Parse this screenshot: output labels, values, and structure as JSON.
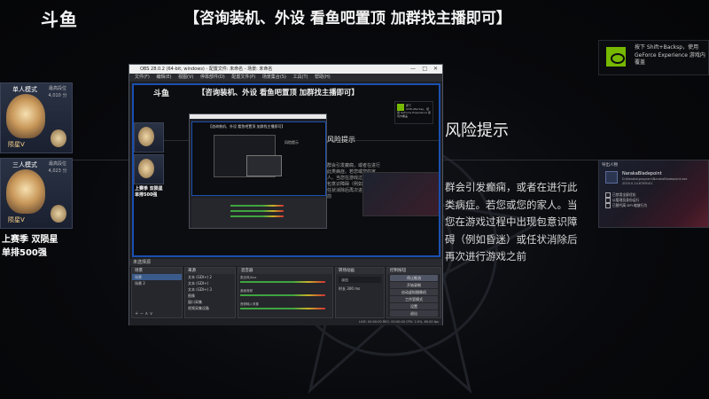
{
  "stream": {
    "logo": "斗鱼",
    "headline": "【咨询装机、外设 看鱼吧置顶 加群找主播即可】",
    "season_line1": "上赛季 双陨星",
    "season_line2": "单排500强",
    "risk_title": "风险提示",
    "warning": "群会引发癫痫，或者在进行此类病症。若您或您的家人。当您在游戏过程中出现包意识障碍（例如昏迷）或任状消除后再次进行游戏之前"
  },
  "rank_cards": [
    {
      "mode": "单人模式",
      "rank": "陨星V",
      "side": "最高段位 4,010 分"
    },
    {
      "mode": "三人模式",
      "rank": "陨星V",
      "side": "最高段位 4,023 分"
    }
  ],
  "obs": {
    "title": "OBS 28.0.2 (64-bit, windows) - 配置文件: 未命名 - 场景: 未命名",
    "menu": [
      "文件(F)",
      "编辑(E)",
      "视图(V)",
      "停靠部件(D)",
      "配置文件(P)",
      "场景集合(S)",
      "工具(T)",
      "帮助(H)"
    ],
    "dock_bar": "未选择源",
    "scenes": {
      "title": "场景",
      "items": [
        "场景",
        "场景 2"
      ]
    },
    "sources": {
      "title": "来源",
      "items": [
        "文本 (GDI+) 2",
        "文本 (GDI+)",
        "文本 (GDI+) 3",
        "图像",
        "窗口采集",
        "视频采集设备"
      ]
    },
    "mixer": {
      "title": "混音器",
      "channels": [
        "麦克风/Aux",
        "桌面音频",
        "音频输入采集"
      ]
    },
    "transitions": {
      "title": "转场动画",
      "value": "淡出",
      "duration_label": "时长",
      "duration": "300 ms"
    },
    "controls": {
      "title": "控制按钮",
      "buttons": [
        "停止推流",
        "开始录制",
        "启动虚拟摄像机",
        "工作室模式",
        "设置",
        "退出"
      ]
    },
    "status": "LIVE: 00:00:00   REC: 00:00:00   CPU: 2.0%, 60.00 fps"
  },
  "nvidia_toast": "按下 Shift+Backsp，使用 GeForce Experience 游戏内覆盖",
  "blaster": {
    "title": "导出人物",
    "name": "NarakaBladepoint",
    "path": "D:\\Naraka\\program\\NarakaBladepoint.exe",
    "version": "2019.0.14.6769101",
    "options": [
      "已禁用全屏优化",
      "以管理员身份运行",
      "已替代高 DPI 缩放行为"
    ]
  }
}
